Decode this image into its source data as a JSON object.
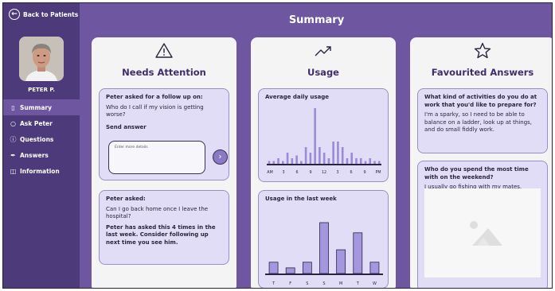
{
  "sidebar": {
    "back_label": "Back to Patients",
    "patient_name": "PETER P.",
    "items": [
      {
        "label": "Summary",
        "icon": "bookmark-icon",
        "active": true
      },
      {
        "label": "Ask Peter",
        "icon": "chat-icon",
        "active": false
      },
      {
        "label": "Questions",
        "icon": "question-icon",
        "active": false
      },
      {
        "label": "Answers",
        "icon": "pen-icon",
        "active": false
      },
      {
        "label": "Information",
        "icon": "book-icon",
        "active": false
      }
    ]
  },
  "header": {
    "title": "Summary"
  },
  "needs_attention": {
    "title": "Needs Attention",
    "card1": {
      "heading": "Peter asked for a follow up on:",
      "question": "Who do I call if my vision is getting worse?",
      "send_label": "Send answer",
      "placeholder": "Enter more details"
    },
    "card2": {
      "heading": "Peter asked:",
      "question": "Can I go back home once I leave the hospital?",
      "note": "Peter has asked this 4 times in the last week. Consider following up next time you see him."
    }
  },
  "usage": {
    "title": "Usage",
    "daily_title": "Average daily usage",
    "weekly_title": "Usage in the last week"
  },
  "favourites": {
    "title": "Favourited Answers",
    "card1": {
      "question": "What kind of activities do you do at work that you'd like to prepare for?",
      "answer": "I'm a sparky, so I need to be able to balance on a ladder, look up at things, and do small fiddly work."
    },
    "card2": {
      "question": "Who do you spend the most time with on the weekend?",
      "answer": "I usually go fishing with my mates."
    }
  },
  "chart_data": [
    {
      "type": "bar",
      "title": "Average daily usage",
      "categories": [
        "AM",
        "",
        "",
        "3",
        "",
        "",
        "6",
        "",
        "",
        "9",
        "",
        "",
        "12",
        "",
        "",
        "3",
        "",
        "",
        "6",
        "",
        "",
        "9",
        "",
        "",
        "PM"
      ],
      "tick_labels": [
        "AM",
        "3",
        "6",
        "9",
        "12",
        "3",
        "6",
        "9",
        "PM"
      ],
      "values": [
        0.5,
        0.5,
        1,
        0.5,
        2,
        1,
        1.5,
        0.5,
        3,
        2,
        10,
        3,
        2,
        1,
        4,
        4,
        3,
        1,
        2,
        1,
        1,
        0.5,
        1,
        0.5,
        0.5
      ],
      "color": "#9a8bd6"
    },
    {
      "type": "bar",
      "title": "Usage in the last week",
      "categories": [
        "T",
        "F",
        "S",
        "S",
        "M",
        "T",
        "W"
      ],
      "values": [
        2,
        1,
        2,
        9,
        4.2,
        7.2,
        2
      ],
      "color": "#a596e0"
    }
  ],
  "colors": {
    "accent": "#6e57a0",
    "sidebar": "#4d3a7a",
    "card": "#e2ddf6",
    "title": "#3f2d6e"
  }
}
